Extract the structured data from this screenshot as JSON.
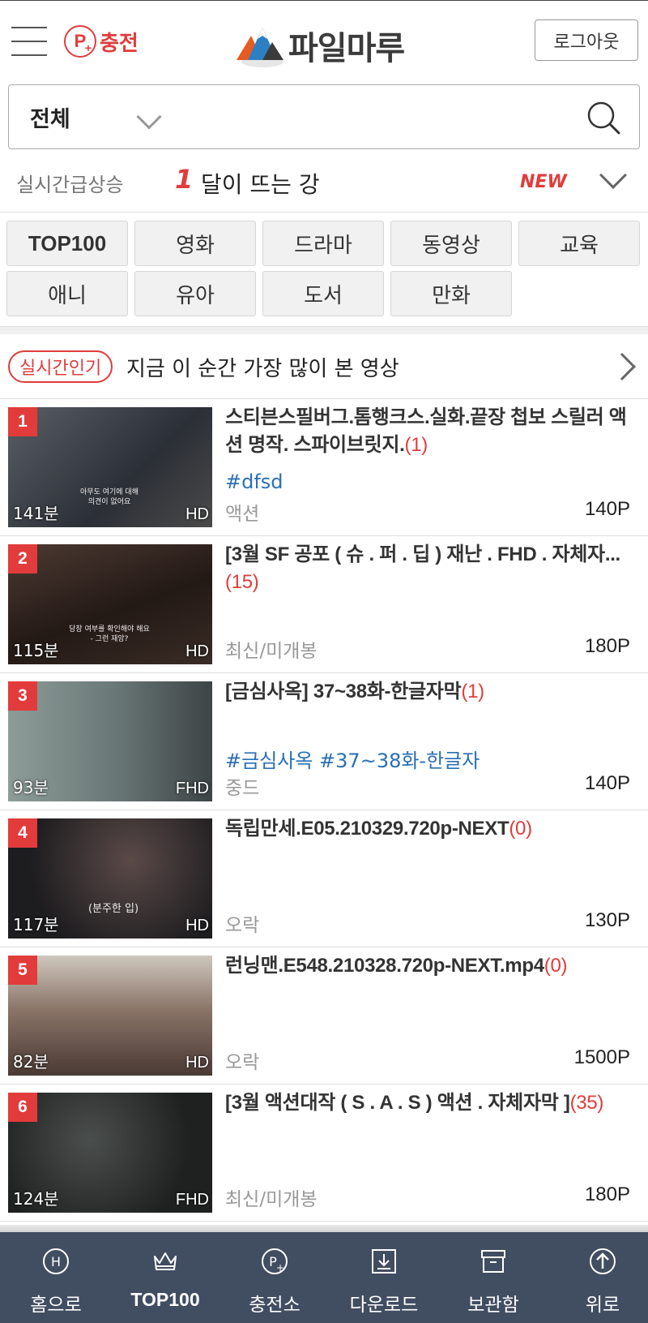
{
  "header": {
    "charge_label": "충전",
    "charge_icon": "P",
    "logo_text": "파일마루",
    "logout_label": "로그아웃"
  },
  "search": {
    "category": "전체"
  },
  "ticker": {
    "label": "실시간급상승",
    "rank": "1",
    "title": "달이 뜨는 강",
    "badge": "NEW"
  },
  "categories": [
    "TOP100",
    "영화",
    "드라마",
    "동영상",
    "교육",
    "애니",
    "유아",
    "도서",
    "만화"
  ],
  "popular": {
    "badge": "실시간인기",
    "title": "지금 이 순간 가장 많이 본 영상"
  },
  "items": [
    {
      "rank": "1",
      "duration": "141분",
      "quality": "HD",
      "title": "스티븐스필버그.톰행크스.실화.끝장 첩보 스릴러 액션 명작. 스파이브릿지.",
      "count": "(1)",
      "tags": "#dfsd",
      "genre": "액션",
      "price": "140P",
      "caption": "아무도 여기에 대해\n의견이 없어요",
      "bg": "#3a3f48"
    },
    {
      "rank": "2",
      "duration": "115분",
      "quality": "HD",
      "title": "[3월 SF 공포 ( 슈 . 퍼 . 딥 ) 재난 . FHD . 자체자...",
      "count": "(15)",
      "tags": "",
      "genre": "최신/미개봉",
      "price": "180P",
      "caption": "당장 여부를 확인해야 해요\n- 그런 재앙?",
      "bg": "#3a2a26"
    },
    {
      "rank": "3",
      "duration": "93분",
      "quality": "FHD",
      "title": "[금심사옥] 37~38화-한글자막",
      "count": "(1)",
      "tags": "#금심사옥 #37~38화-한글자",
      "genre": "중드",
      "price": "140P",
      "caption": "",
      "bg": "#7b8a86"
    },
    {
      "rank": "4",
      "duration": "117분",
      "quality": "HD",
      "title": "독립만세.E05.210329.720p-NEXT",
      "count": "(0)",
      "tags": "",
      "genre": "오락",
      "price": "130P",
      "caption": "(분주한          입)",
      "bg": "#2b2a2c"
    },
    {
      "rank": "5",
      "duration": "82분",
      "quality": "HD",
      "title": "런닝맨.E548.210328.720p-NEXT.mp4",
      "count": "(0)",
      "tags": "",
      "genre": "오락",
      "price": "1500P",
      "caption": "",
      "bg": "#6b5a52"
    },
    {
      "rank": "6",
      "duration": "124분",
      "quality": "FHD",
      "title": "[3월 액션대작 ( S . A . S ) 액션 . 자체자막 ]",
      "count": "(35)",
      "tags": "",
      "genre": "최신/미개봉",
      "price": "180P",
      "caption": "",
      "bg": "#2e3130"
    }
  ],
  "bottom_nav": [
    {
      "label": "홈으로",
      "icon": "home-icon"
    },
    {
      "label": "TOP100",
      "icon": "crown-icon"
    },
    {
      "label": "충전소",
      "icon": "charge-icon"
    },
    {
      "label": "다운로드",
      "icon": "download-icon"
    },
    {
      "label": "보관함",
      "icon": "archive-icon"
    },
    {
      "label": "위로",
      "icon": "arrow-up-icon"
    }
  ],
  "colors": {
    "accent": "#e23b3b",
    "link": "#2a6fb5",
    "nav_bg": "#3e4a5e"
  }
}
